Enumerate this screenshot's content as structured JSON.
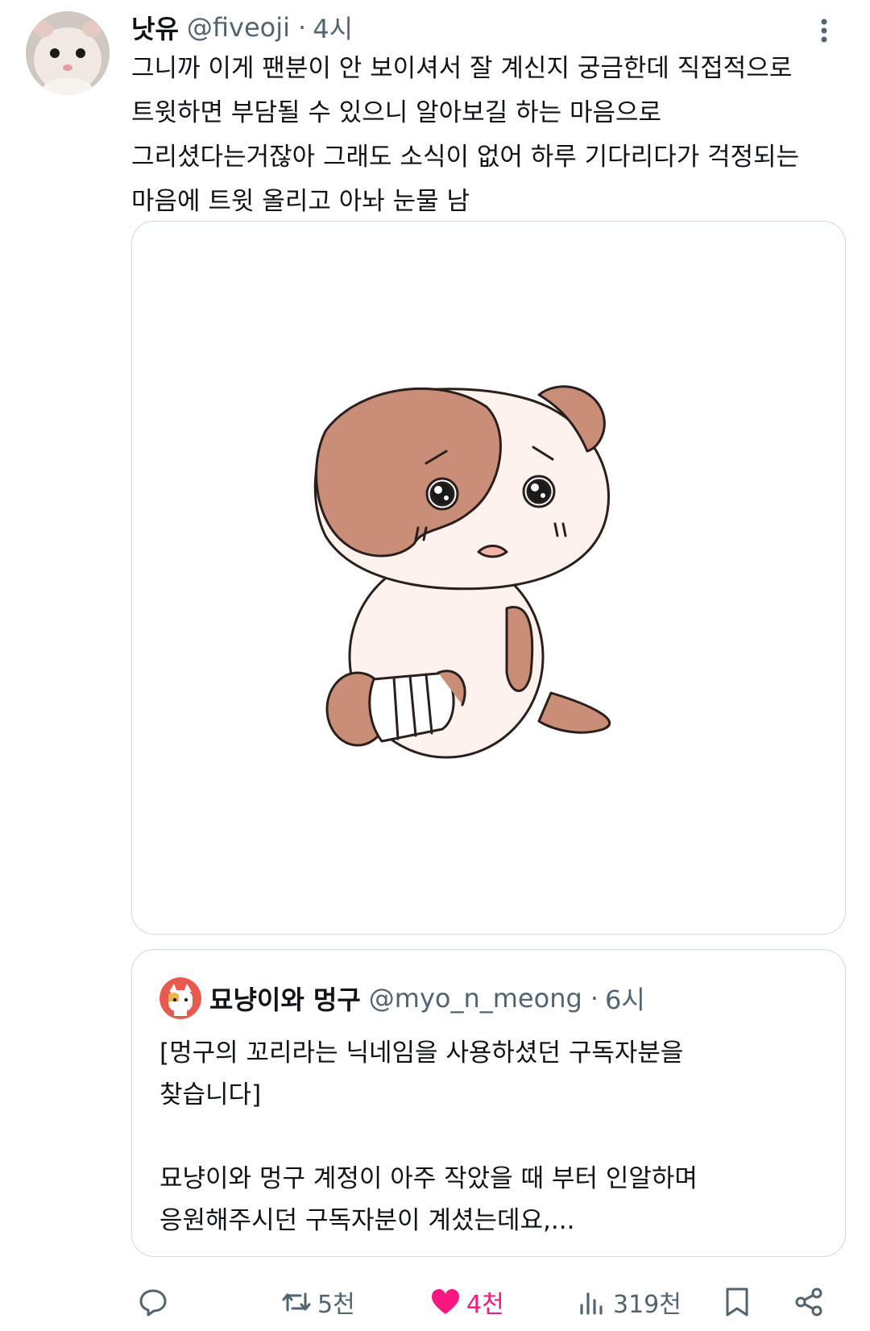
{
  "tweet": {
    "display_name": "낫유",
    "handle": "@fiveoji",
    "separator": "·",
    "time": "4시",
    "text_lines": [
      "그니까 이게 팬분이 안 보이셔서 잘 계신지 궁금한데 직접적으로",
      "트윗하면 부담될 수 있으니 알아보길 하는 마음으로",
      "그리셨다는거잖아 그래도 소식이 없어 하루 기다리다가 걱정되는",
      "마음에 트윗 올리고 아놔 눈물 남"
    ]
  },
  "quote": {
    "display_name": "묘냥이와 멍구",
    "handle": "@myo_n_meong",
    "separator": "·",
    "time": "6시",
    "text_lines": [
      "[멍구의 꼬리라는 닉네임을 사용하셨던 구독자분을",
      "찾습니다]",
      "",
      "묘냥이와 멍구 계정이 아주 작았을 때 부터 인알하며",
      "응원해주시던 구독자분이 계셨는데요,..."
    ]
  },
  "actions": {
    "reply_icon": "reply-icon",
    "retweet_count": "5천",
    "like_count": "4천",
    "views_count": "319천",
    "bookmark_icon": "bookmark-icon",
    "share_icon": "share-icon"
  },
  "colors": {
    "text": "#0f1419",
    "muted": "#536471",
    "border": "#cfd9de",
    "like": "#f91880",
    "puppy_fur": "#c98e78",
    "puppy_body": "#fdf3ec"
  }
}
